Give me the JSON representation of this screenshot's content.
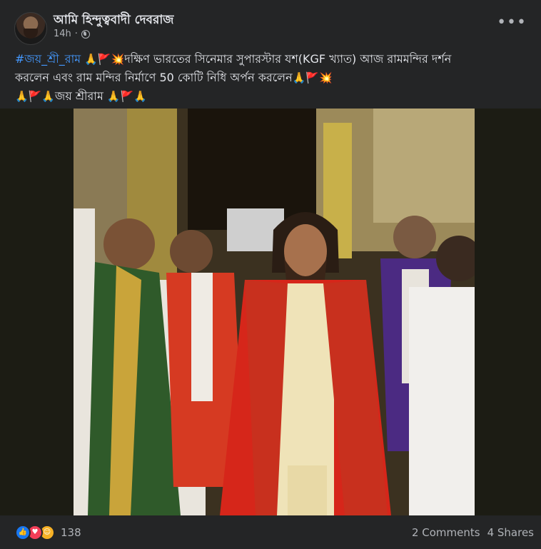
{
  "post": {
    "author": "আমি হিন্দুত্ববাদী দেবরাজ",
    "time": "14h",
    "hashtag": "#জয়_শ্রী_রাম",
    "line1_emojis": "🙏🚩💥",
    "line1_text": "দক্ষিণ ভারতের সিনেমার সুপারস্টার যশ(KGF খ্যাত) আজ রামমন্দির দর্শন",
    "line2_text": "করলেন এবং রাম মন্দির নির্মাণে 50 কোটি নিধি অর্পন করলেন",
    "line2_emojis": "🙏🚩💥",
    "line3_emojis_before": "🙏🚩🙏",
    "line3_text": "জয় শ্রীরাম",
    "line3_emojis_after": "🙏🚩🙏"
  },
  "footer": {
    "reaction_count": "138",
    "comments": "2 Comments",
    "shares": "4 Shares"
  },
  "icons": {
    "globe": "globe-icon",
    "more": "more-icon",
    "like": "like-icon",
    "love": "love-icon",
    "care": "care-icon"
  }
}
